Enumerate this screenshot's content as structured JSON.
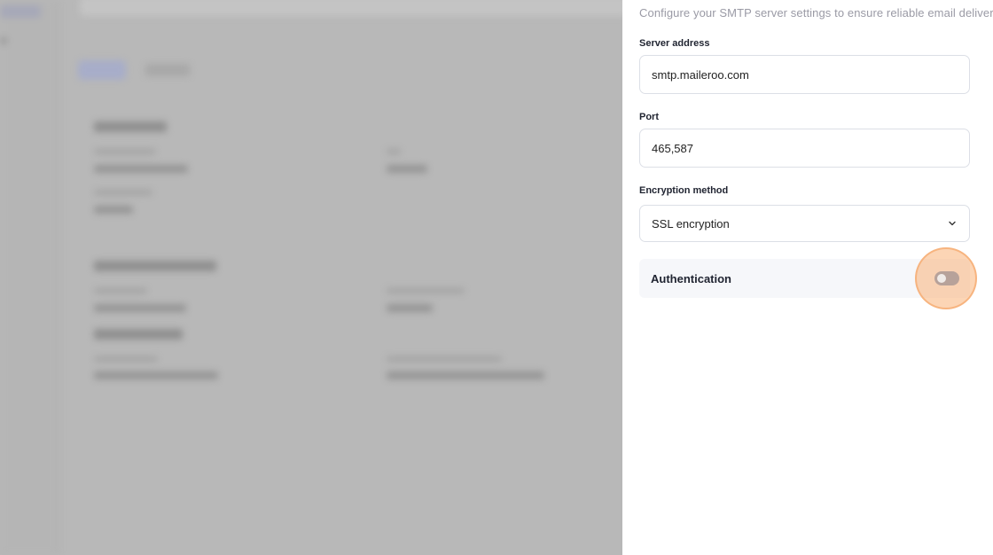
{
  "drawer": {
    "subtitle": "Configure your SMTP server settings to ensure reliable email delivery",
    "server_address": {
      "label": "Server address",
      "value": "smtp.maileroo.com"
    },
    "port": {
      "label": "Port",
      "value": "465,587"
    },
    "encryption": {
      "label": "Encryption method",
      "value": "SSL encryption"
    },
    "authentication": {
      "label": "Authentication",
      "enabled": false
    }
  },
  "colors": {
    "accent_highlight": "#fab278",
    "toggle_off": "#b7a29a",
    "overlay": "#b8b8b8"
  },
  "icons": {
    "select_chevron": "chevron-down-icon"
  }
}
